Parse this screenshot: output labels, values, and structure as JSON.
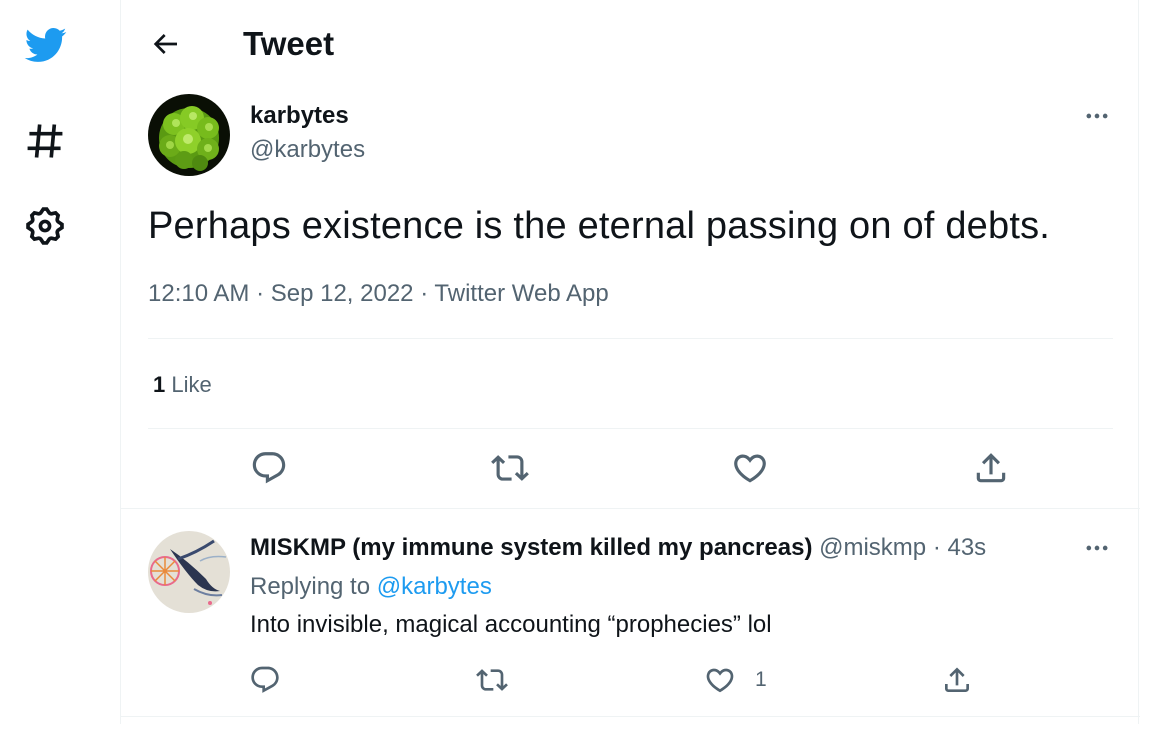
{
  "colors": {
    "brand": "#1d9bf0",
    "text": "#0f1419",
    "secondary": "#536471",
    "border": "#eff3f4"
  },
  "sidebar": {
    "items": [
      {
        "icon": "twitter-bird-icon"
      },
      {
        "icon": "hashtag-icon"
      },
      {
        "icon": "gear-icon"
      }
    ]
  },
  "header": {
    "title": "Tweet",
    "back_icon": "arrow-left-icon"
  },
  "tweet": {
    "author_name": "karbytes",
    "author_handle": "@karbytes",
    "text": "Perhaps existence is the eternal passing on of debts.",
    "meta": "12:10 AM · Sep 12, 2022 · Twitter Web App",
    "likes_count": "1",
    "likes_label": "Like",
    "actions": [
      "reply-icon",
      "retweet-icon",
      "like-icon",
      "share-icon"
    ]
  },
  "reply": {
    "author_name": "MISKMP (my immune system killed my pancreas)",
    "author_handle": "@miskmp",
    "separator": "·",
    "time": "43s",
    "replying_prefix": "Replying to",
    "replying_to": "@karbytes",
    "text": "Into invisible, magical accounting “prophecies” lol",
    "like_count": "1"
  }
}
